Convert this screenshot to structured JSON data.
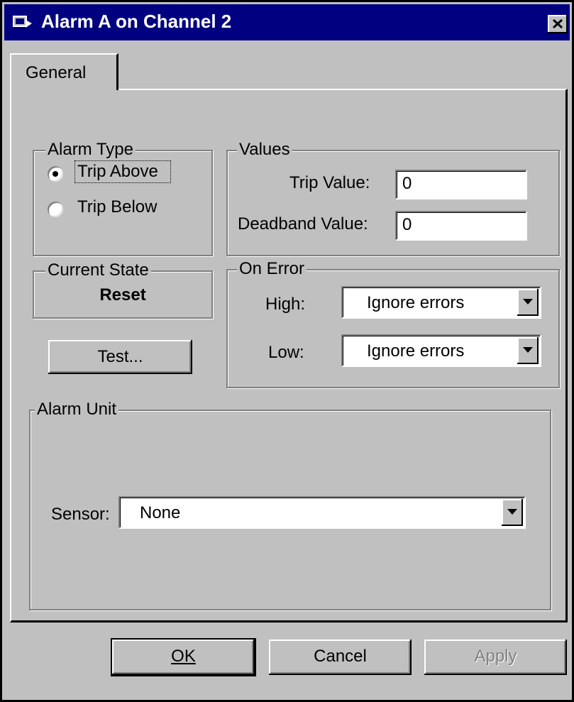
{
  "window": {
    "title": "Alarm A on Channel 2"
  },
  "tabs": [
    {
      "label": "General"
    }
  ],
  "alarm_type": {
    "label": "Alarm Type",
    "options": [
      {
        "label": "Trip Above",
        "selected": true
      },
      {
        "label": "Trip Below",
        "selected": false
      }
    ]
  },
  "values": {
    "label": "Values",
    "trip_value_label": "Trip Value:",
    "trip_value": "0",
    "deadband_label": "Deadband Value:",
    "deadband_value": "0"
  },
  "current_state": {
    "label": "Current State",
    "value": "Reset"
  },
  "test_button": "Test...",
  "on_error": {
    "label": "On Error",
    "high_label": "High:",
    "high_value": "Ignore errors",
    "low_label": "Low:",
    "low_value": "Ignore errors"
  },
  "alarm_unit": {
    "label": "Alarm Unit",
    "sensor_label": "Sensor:",
    "sensor_value": "None"
  },
  "buttons": {
    "ok": "OK",
    "cancel": "Cancel",
    "apply": "Apply"
  }
}
